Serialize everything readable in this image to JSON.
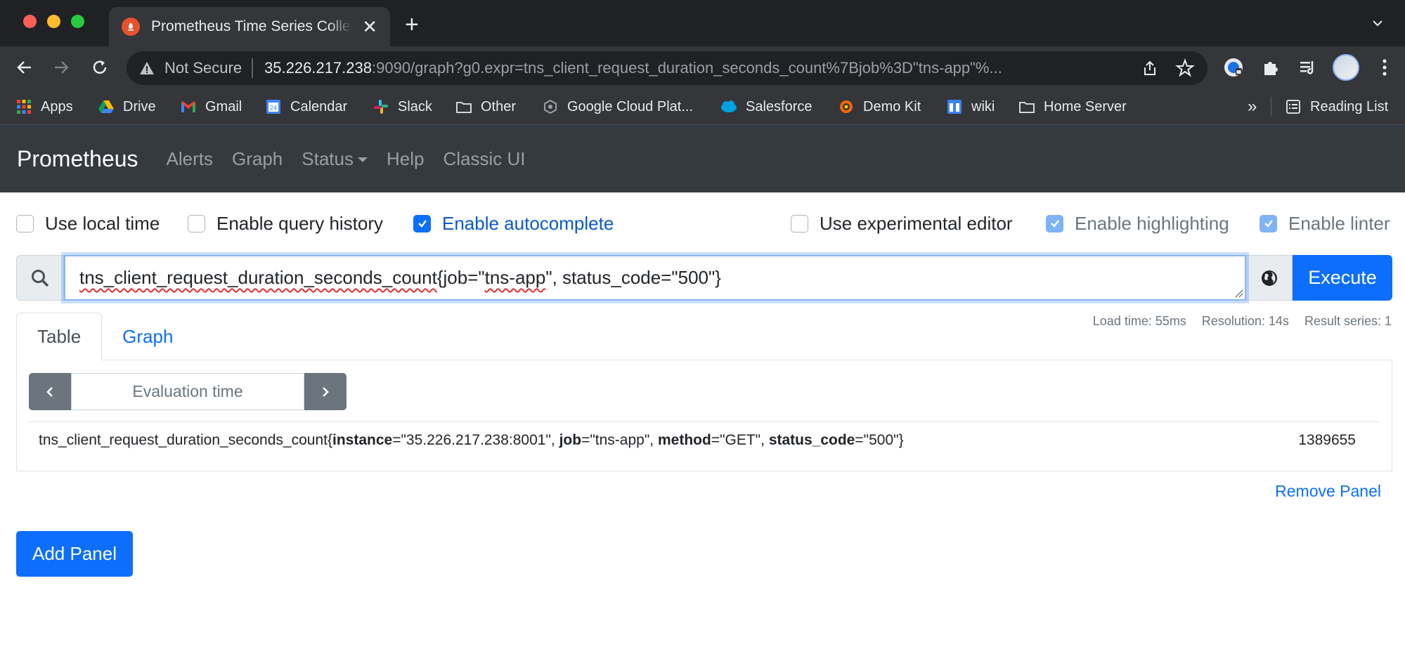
{
  "browser": {
    "tab_title": "Prometheus Time Series Collection and Processing Server",
    "tab_close": "✕",
    "new_tab": "+",
    "security_label": "Not Secure",
    "url_host": "35.226.217.238",
    "url_rest": ":9090/graph?g0.expr=tns_client_request_duration_seconds_count%7Bjob%3D\"tns-app\"%...",
    "bookmarks": [
      "Apps",
      "Drive",
      "Gmail",
      "Calendar",
      "Slack",
      "Other",
      "Google Cloud Plat...",
      "Salesforce",
      "Demo Kit",
      "wiki",
      "Home Server"
    ],
    "bookmarks_more": "»",
    "reading_list": "Reading List"
  },
  "nav": {
    "brand": "Prometheus",
    "links": [
      "Alerts",
      "Graph",
      "Status",
      "Help",
      "Classic UI"
    ]
  },
  "options": {
    "local_time": {
      "label": "Use local time",
      "checked": false
    },
    "query_history": {
      "label": "Enable query history",
      "checked": false
    },
    "autocomplete": {
      "label": "Enable autocomplete",
      "checked": true
    },
    "experimental_editor": {
      "label": "Use experimental editor",
      "checked": false
    },
    "highlighting": {
      "label": "Enable highlighting",
      "checked": true
    },
    "linter": {
      "label": "Enable linter",
      "checked": true
    }
  },
  "query": {
    "metric": "tns_client_request_duration_seconds_count",
    "brace_open": "{job=\"",
    "job_value": "tns-app",
    "rest": "\", status_code=\"500\"}",
    "execute_label": "Execute"
  },
  "panel": {
    "tabs": [
      "Table",
      "Graph"
    ],
    "stats": {
      "load_time": "Load time: 55ms",
      "resolution": "Resolution: 14s",
      "result_series": "Result series: 1"
    },
    "eval_placeholder": "Evaluation time",
    "result": {
      "metric_name": "tns_client_request_duration_seconds_count",
      "labels": [
        {
          "key": "instance",
          "value": "\"35.226.217.238:8001\""
        },
        {
          "key": "job",
          "value": "\"tns-app\""
        },
        {
          "key": "method",
          "value": "\"GET\""
        },
        {
          "key": "status_code",
          "value": "\"500\""
        }
      ],
      "value": "1389655"
    },
    "remove_label": "Remove Panel"
  },
  "add_panel_label": "Add Panel",
  "colors": {
    "accent": "#0d6efd",
    "navbar": "#343a40",
    "browser_dark": "#202124"
  }
}
